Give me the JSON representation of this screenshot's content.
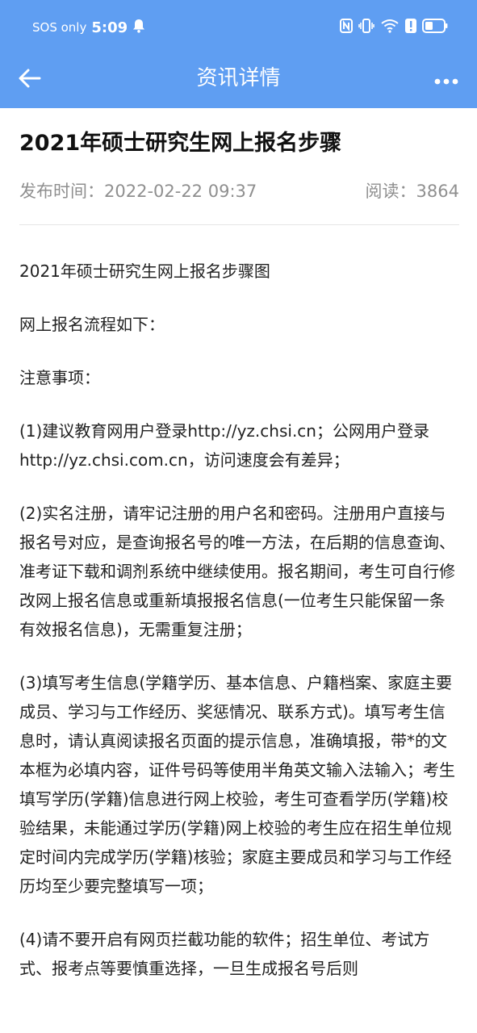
{
  "status_bar": {
    "carrier": "SOS only",
    "time": "5:09",
    "icons": [
      "notification-bell-icon",
      "nfc-icon",
      "vibrate-icon",
      "wifi-icon",
      "alert-icon",
      "battery-icon"
    ]
  },
  "nav": {
    "title": "资讯详情",
    "back_icon": "back-arrow-icon",
    "more_icon": "more-icon"
  },
  "article": {
    "title": "2021年硕士研究生网上报名步骤",
    "publish_label": "发布时间：2022-02-22 09:37",
    "read_label": "阅读：3864",
    "paragraphs": [
      "2021年硕士研究生网上报名步骤图",
      "网上报名流程如下：",
      "注意事项：",
      "(1)建议教育网用户登录http://yz.chsi.cn；公网用户登录http://yz.chsi.com.cn，访问速度会有差异；",
      "(2)实名注册，请牢记注册的用户名和密码。注册用户直接与报名号对应，是查询报名号的唯一方法，在后期的信息查询、准考证下载和调剂系统中继续使用。报名期间，考生可自行修改网上报名信息或重新填报报名信息(一位考生只能保留一条有效报名信息)，无需重复注册；",
      "(3)填写考生信息(学籍学历、基本信息、户籍档案、家庭主要成员、学习与工作经历、奖惩情况、联系方式)。填写考生信息时，请认真阅读报名页面的提示信息，准确填报，带*的文本框为必填内容，证件号码等使用半角英文输入法输入；考生填写学历(学籍)信息进行网上校验，考生可查看学历(学籍)校验结果，未能通过学历(学籍)网上校验的考生应在招生单位规定时间内完成学历(学籍)核验；家庭主要成员和学习与工作经历均至少要完整填写一项；",
      "(4)请不要开启有网页拦截功能的软件；招生单位、考试方式、报考点等要慎重选择，一旦生成报名号后则"
    ]
  },
  "colors": {
    "header_bg": "#5f9ef2",
    "meta_text": "#8f8f8f"
  }
}
